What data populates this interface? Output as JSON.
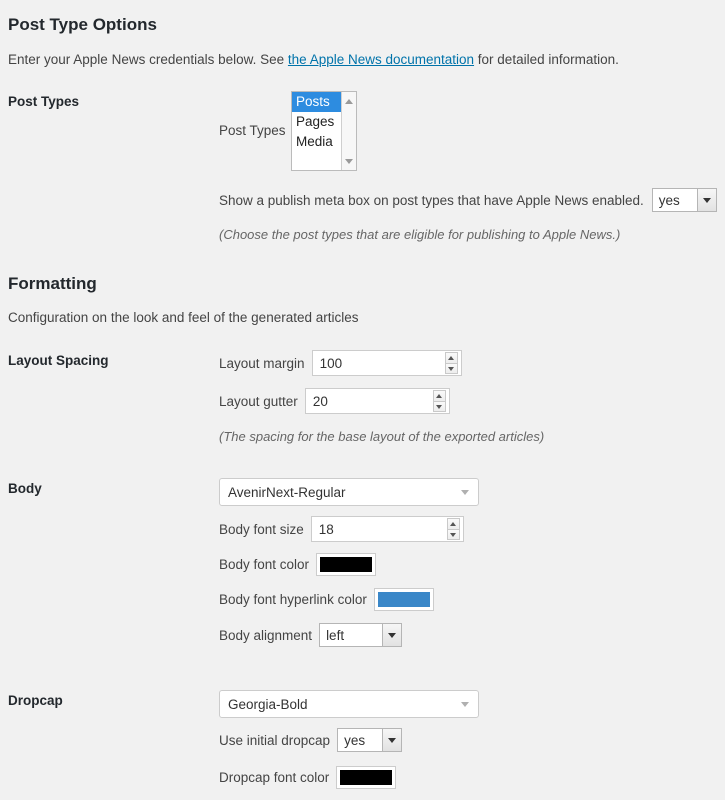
{
  "post_type_options": {
    "heading": "Post Type Options",
    "intro_before": "Enter your Apple News credentials below. See ",
    "intro_link": "the Apple News documentation",
    "intro_after": " for detailed information.",
    "row_label": "Post Types",
    "post_types_field_label": "Post Types",
    "post_types_options": [
      {
        "label": "Posts",
        "selected": true
      },
      {
        "label": "Pages",
        "selected": false
      },
      {
        "label": "Media",
        "selected": false
      }
    ],
    "meta_box_label": "Show a publish meta box on post types that have Apple News enabled.",
    "meta_box_value": "yes",
    "note": "(Choose the post types that are eligible for publishing to Apple News.)"
  },
  "formatting": {
    "heading": "Formatting",
    "subtext": "Configuration on the look and feel of the generated articles",
    "layout_spacing": {
      "row_label": "Layout Spacing",
      "margin_label": "Layout margin",
      "margin_value": "100",
      "gutter_label": "Layout gutter",
      "gutter_value": "20",
      "note": "(The spacing for the base layout of the exported articles)"
    },
    "body": {
      "row_label": "Body",
      "font_value": "AvenirNext-Regular",
      "font_size_label": "Body font size",
      "font_size_value": "18",
      "font_color_label": "Body font color",
      "font_color_value": "#000000",
      "hyperlink_color_label": "Body font hyperlink color",
      "hyperlink_color_value": "#3a87c8",
      "alignment_label": "Body alignment",
      "alignment_value": "left"
    },
    "dropcap": {
      "row_label": "Dropcap",
      "font_value": "Georgia-Bold",
      "use_label": "Use initial dropcap",
      "use_value": "yes",
      "font_color_label": "Dropcap font color",
      "font_color_value": "#000000"
    }
  },
  "icons": {
    "scroll_up": "scroll-up-arrow-icon",
    "scroll_down": "scroll-down-arrow-icon",
    "chevron": "chevron-down-icon",
    "spinner_up": "spinner-up-icon",
    "spinner_down": "spinner-down-icon"
  },
  "colors": {
    "background": "#f1f1f1",
    "link": "#0073aa",
    "selection": "#2d8ce0"
  }
}
